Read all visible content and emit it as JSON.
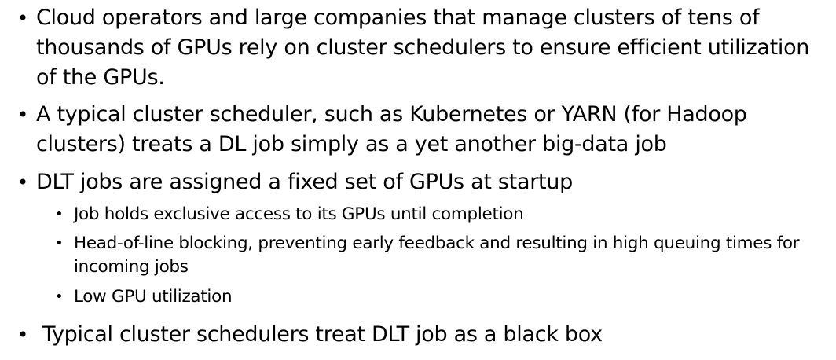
{
  "slide": {
    "bullets": [
      {
        "text": "Cloud operators and large companies that manage clusters of tens of thousands of GPUs rely on cluster schedulers to ensure efficient utilization of the GPUs."
      },
      {
        "text": "A typical cluster scheduler, such as Kubernetes or YARN (for Hadoop clusters) treats a DL job simply as a yet another big-data job"
      },
      {
        "text": "DLT jobs are assigned a fixed set of GPUs at startup",
        "sub": [
          {
            "text": "Job holds exclusive access to its GPUs until completion"
          },
          {
            "text": "Head-of-line blocking, preventing early feedback and resulting in high queuing times for incoming jobs"
          },
          {
            "text": "Low GPU utilization"
          }
        ]
      },
      {
        "text": "Typical cluster schedulers treat DLT job as a black box"
      }
    ],
    "bullet_glyph": "•"
  }
}
